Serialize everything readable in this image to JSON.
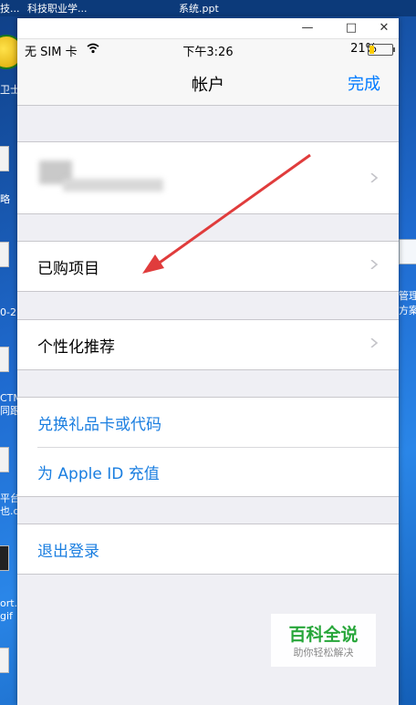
{
  "desktop": {
    "top_texts": [
      "技...",
      "科技职业学...",
      "系统.ppt"
    ],
    "left_labels": [
      "卫士",
      "略",
      "0-2...",
      "CTM\n同跟...",
      "平台\n也.d...",
      "ort...\ngif"
    ],
    "right_labels": [
      "管理",
      "方案"
    ]
  },
  "window": {
    "minimize": "—",
    "maximize": "□",
    "close": "✕"
  },
  "status_bar": {
    "carrier": "无 SIM 卡",
    "time": "下午3:26",
    "battery": "21%",
    "battery_level": 0.21
  },
  "nav": {
    "title": "帐户",
    "done": "完成"
  },
  "rows": {
    "purchased": "已购项目",
    "personalized": "个性化推荐",
    "redeem": "兑换礼品卡或代码",
    "add_funds": "为 Apple ID 充值",
    "sign_out": "退出登录"
  },
  "watermark": {
    "title": "百科全说",
    "subtitle": "助你轻松解决"
  },
  "colors": {
    "link": "#1a7ee0",
    "done": "#007aff",
    "annotation_arrow": "#e03c3c"
  }
}
